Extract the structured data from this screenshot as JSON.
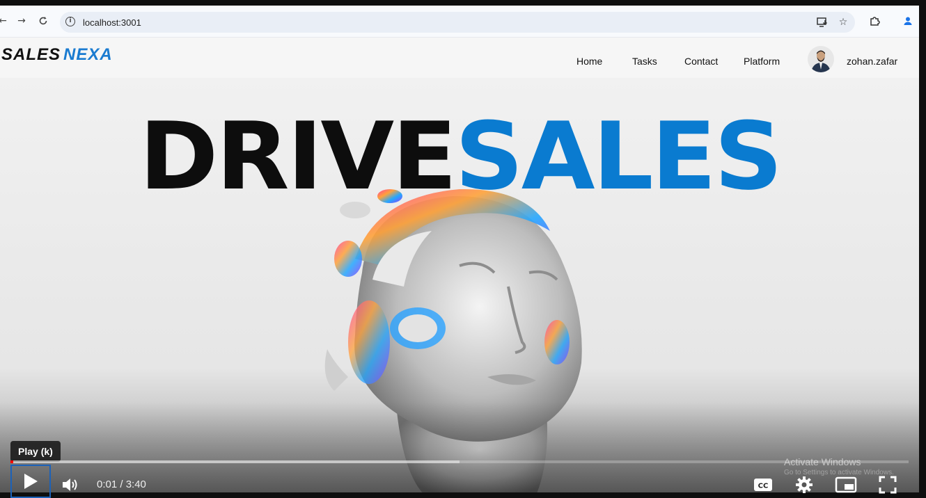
{
  "browser": {
    "url": "localhost:3001",
    "icons": [
      "back-arrow-icon",
      "forward-arrow-icon",
      "reload-icon",
      "site-info-icon",
      "install-app-icon",
      "bookmark-star-icon",
      "extensions-puzzle-icon",
      "profile-icon"
    ]
  },
  "site": {
    "logo_part1": "SALES",
    "logo_part2": "NEXA",
    "nav": [
      {
        "label": "Home"
      },
      {
        "label": "Tasks"
      },
      {
        "label": "Contact"
      },
      {
        "label": "Platform"
      }
    ],
    "username": "zohan.zafar"
  },
  "hero": {
    "headline_dark": "DRIVE",
    "headline_blue": "SALES"
  },
  "player": {
    "tooltip": "Play (k)",
    "time": "0:01 / 3:40",
    "progress_played_fraction": 0.003,
    "progress_buffered_fraction": 0.5,
    "icons": [
      "play-icon",
      "volume-icon",
      "captions-icon",
      "settings-gear-icon",
      "miniplayer-icon",
      "fullscreen-icon"
    ]
  },
  "watermark": {
    "title": "Activate Windows",
    "subtitle": "Go to Settings to activate Windows."
  },
  "colors": {
    "brand_blue": "#0a7bd0",
    "headline_dark": "#0d0d0d",
    "progress_red": "#ff0000",
    "focus_outline": "#1c62b9"
  }
}
